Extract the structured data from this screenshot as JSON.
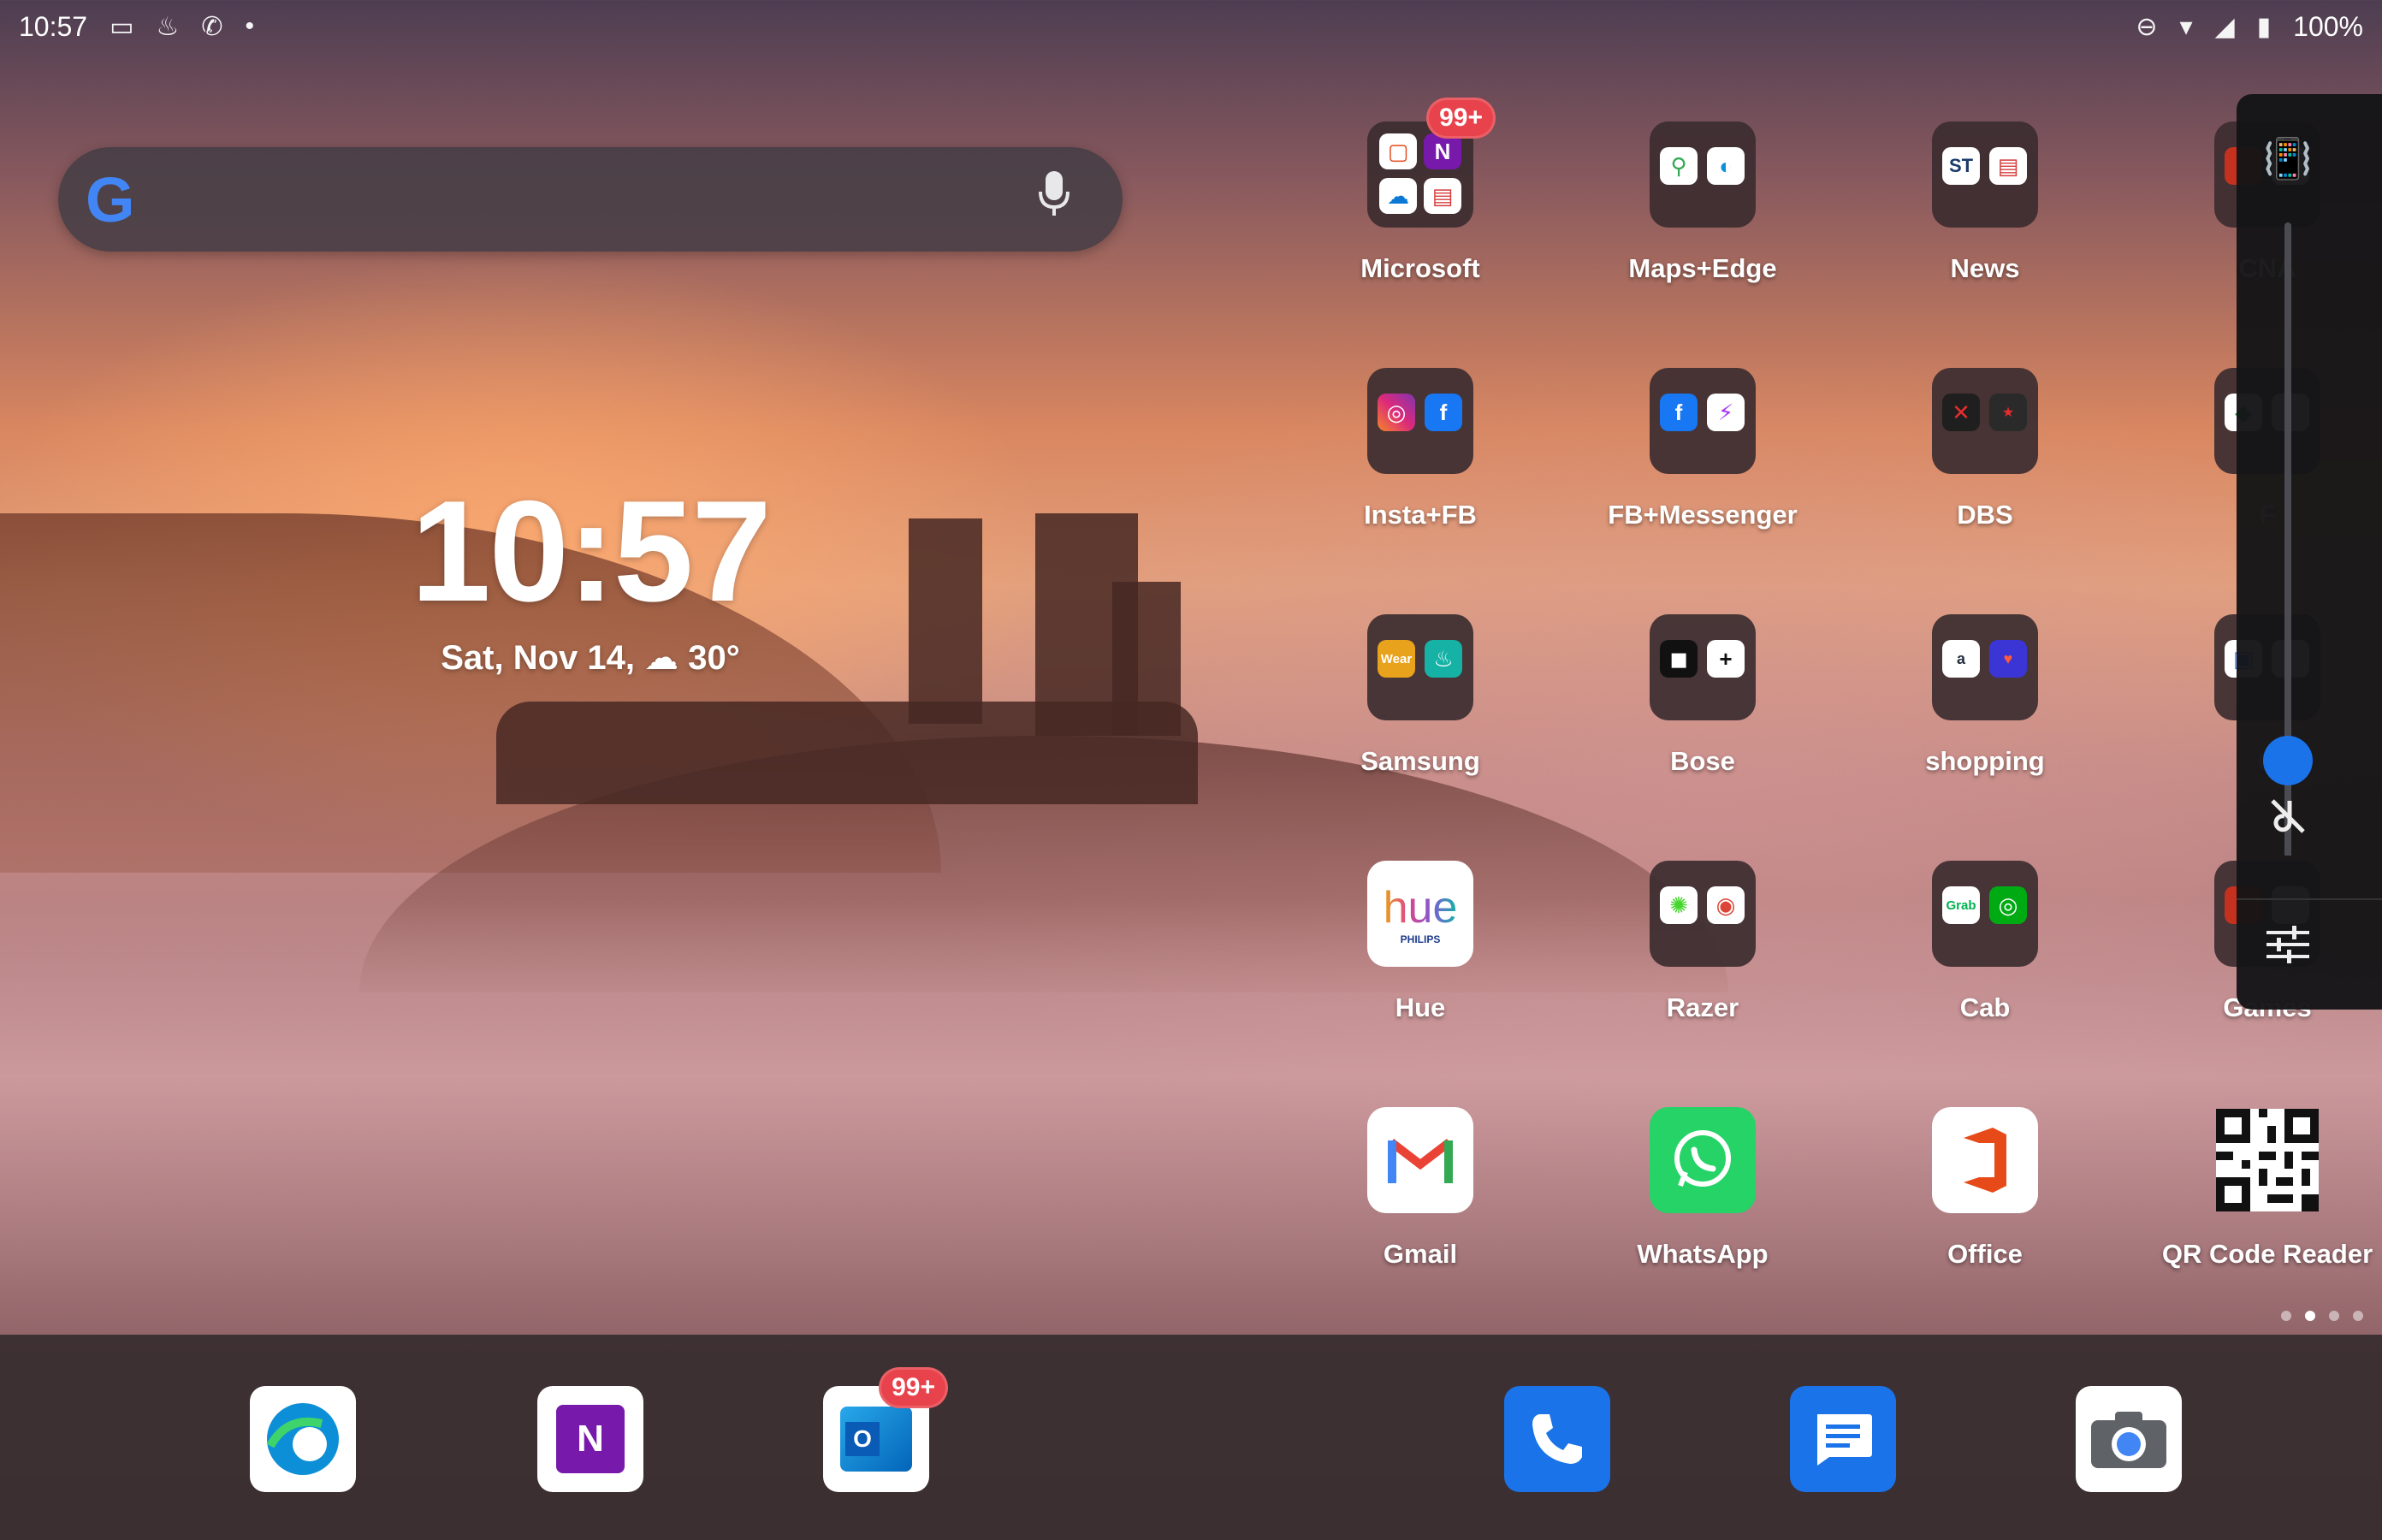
{
  "status_bar": {
    "time": "10:57",
    "battery": "100%"
  },
  "search": {
    "google_glyph": "G"
  },
  "clock_widget": {
    "time": "10:57",
    "date": "Sat, Nov 14,",
    "temperature": "30°"
  },
  "apps": {
    "microsoft": {
      "label": "Microsoft",
      "badge": "99+"
    },
    "maps_edge": {
      "label": "Maps+Edge"
    },
    "news": {
      "label": "News"
    },
    "cna": {
      "label": "CNA"
    },
    "insta_fb": {
      "label": "Insta+FB"
    },
    "fb_messenger": {
      "label": "FB+Messenger"
    },
    "dbs": {
      "label": "DBS"
    },
    "col4_row2": {
      "label": "F"
    },
    "samsung": {
      "label": "Samsung"
    },
    "bose": {
      "label": "Bose"
    },
    "shopping": {
      "label": "shopping"
    },
    "col4_row3": {
      "label": "G"
    },
    "hue": {
      "label": "Hue",
      "icon_text": "hue",
      "icon_sub": "PHILIPS"
    },
    "razer": {
      "label": "Razer"
    },
    "cab": {
      "label": "Cab"
    },
    "games": {
      "label": "Games"
    },
    "gmail": {
      "label": "Gmail"
    },
    "whatsapp": {
      "label": "WhatsApp"
    },
    "office": {
      "label": "Office"
    },
    "qr": {
      "label": "QR Code Reader"
    }
  },
  "mini_icons": {
    "wear": "Wear",
    "grab": "Grab",
    "st": "ST"
  },
  "volume_panel": {
    "level": 0.15
  },
  "page_indicator": {
    "pages": 4,
    "current": 1
  },
  "dock": {
    "outlook_badge": "99+",
    "onenote_letter": "N",
    "outlook_letter": "O"
  },
  "colors": {
    "accent_blue": "#1a73e8",
    "badge_red": "#e8434c",
    "whatsapp_green": "#25D366",
    "office_red": "#e64a19"
  }
}
